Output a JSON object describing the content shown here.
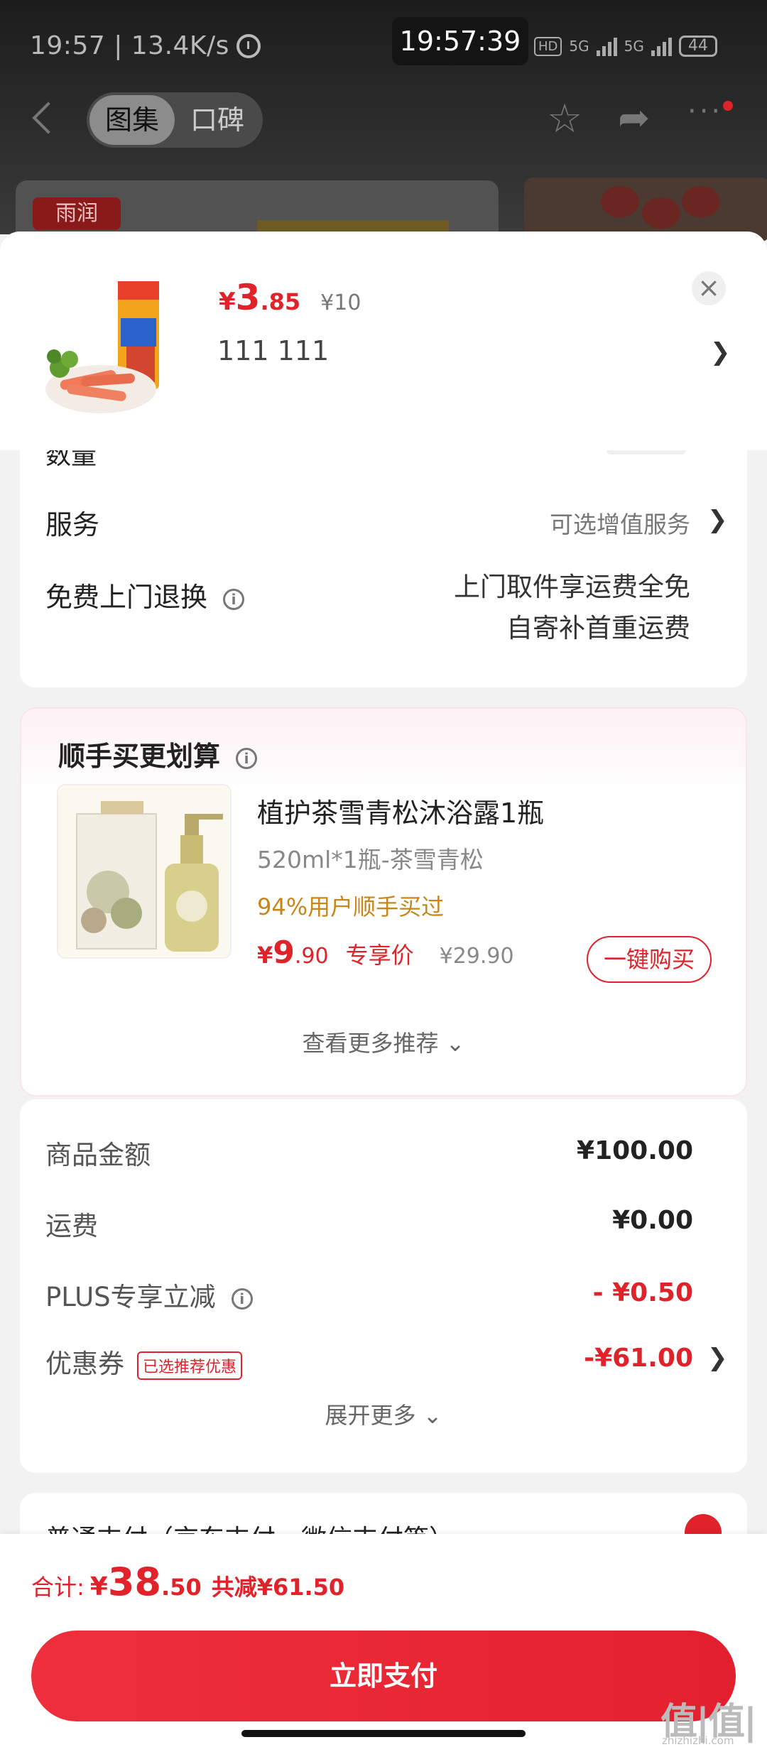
{
  "status_bar": {
    "left_text": "19:57 | 13.4K/s",
    "clock": "19:57:39",
    "hd": "HD",
    "net1": "5G",
    "net2": "5G",
    "battery": "44"
  },
  "nav": {
    "tabs": [
      {
        "label": "图集",
        "active": true
      },
      {
        "label": "口碑",
        "active": false
      }
    ]
  },
  "background": {
    "brand_logo": "雨润"
  },
  "product": {
    "currency": "¥",
    "price_int": "3",
    "price_dec": ".85",
    "original_price": "¥10",
    "spec": "111  111",
    "close_icon": "×"
  },
  "service_card": {
    "quantity_label": "数量",
    "service_label": "服务",
    "service_value": "可选增值服务",
    "return_label": "免费上门退换",
    "return_value_line1": "上门取件享运费全免",
    "return_value_line2": "自寄补首重运费"
  },
  "addon": {
    "title": "顺手买更划算",
    "name": "植护茶雪青松沐浴露1瓶",
    "spec": "520ml*1瓶-茶雪青松",
    "social": "94%用户顺手买过",
    "currency": "¥",
    "price_int": "9",
    "price_dec": ".90",
    "price_tag": "专享价",
    "original_price": "¥29.90",
    "buy_label": "一键购买",
    "more_label": "查看更多推荐 ⌄"
  },
  "summary": {
    "rows": [
      {
        "label": "商品金额",
        "value": "¥100.00"
      },
      {
        "label": "运费",
        "value": "¥0.00"
      },
      {
        "label": "PLUS专享立减",
        "value": "- ¥0.50"
      },
      {
        "label": "优惠券",
        "value": "-¥61.00",
        "tag": "已选推荐优惠"
      }
    ],
    "expand_label": "展开更多 ⌄"
  },
  "payment": {
    "label": "普通支付（京东支付、微信支付等）"
  },
  "bottom": {
    "total_label": "合计:",
    "total_currency": "¥",
    "total_int": "38",
    "total_dec": ".50",
    "saved": "共减¥61.50",
    "pay_label": "立即支付"
  },
  "watermark": {
    "logo": "值|值|值",
    "url": "zhizhizhi.com"
  },
  "colors": {
    "accent": "#e0232a",
    "gold": "#c8861a"
  }
}
